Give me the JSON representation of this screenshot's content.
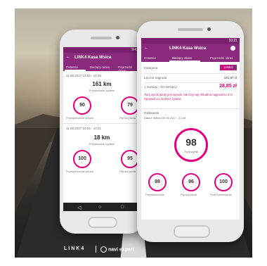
{
  "back_phone": {
    "status": "9:41",
    "title": "LINK4 Kasa Wsica",
    "tabs": [
      "Ostatnia",
      "Bieżący okres",
      "Poprzedni okres"
    ],
    "trip1": {
      "date": "11.08.2017 13:55 - 14:34",
      "distance": "161 km",
      "distance_caption": "Przejechane ogółem",
      "score_left": "90",
      "score_left_caption": "Przyspieszanie pauza",
      "score_right": "79",
      "score_right_caption": "Płynna jazda"
    },
    "trip2": {
      "date": "11.08.2017 10:04 - 14:21",
      "distance": "18 km",
      "distance_caption": "Przejechane ogółem",
      "score_left": "100",
      "score_left_caption": "Przyspieszanie pauza",
      "score_right": "95",
      "score_right_caption": "Płynna jazda"
    },
    "nav": [
      "◁",
      "○",
      "□"
    ]
  },
  "front_phone": {
    "status": "10:21",
    "title": "LINK4 Kasa Wsica",
    "tabs": [
      "Ostatnia",
      "Bieżący okres",
      "Poprzedni okres"
    ],
    "row1_label": "Kategoria",
    "row1_value": "LINK4",
    "row2_label": "Łączna nagroda",
    "row2_value": "101,87 zł",
    "row3_label": "1 miesiąc - 30 miesięcy",
    "row3_value": "28,85 zł",
    "promo_text": "Twój wynik jazdy jest wysoki, tak trzymaj! Aktualna nagroda to 3 zł. Sprawdź co możesz zyskać.",
    "period_label": "Datakwota",
    "period_range": "Data z okresu 30.06.2017 - 12.08",
    "main_score": "98",
    "main_caption": "Twój wynik",
    "small_scores": [
      {
        "value": "98",
        "caption": "Przyspieszanie"
      },
      {
        "value": "96",
        "caption": "Płynna jazda"
      },
      {
        "value": "100",
        "caption": "Profil hamowania"
      }
    ]
  },
  "branding": {
    "link4": "LINK4",
    "partner": "navi expert"
  },
  "colors": {
    "accent": "#8a2a7d",
    "ring": "#e3007d"
  }
}
